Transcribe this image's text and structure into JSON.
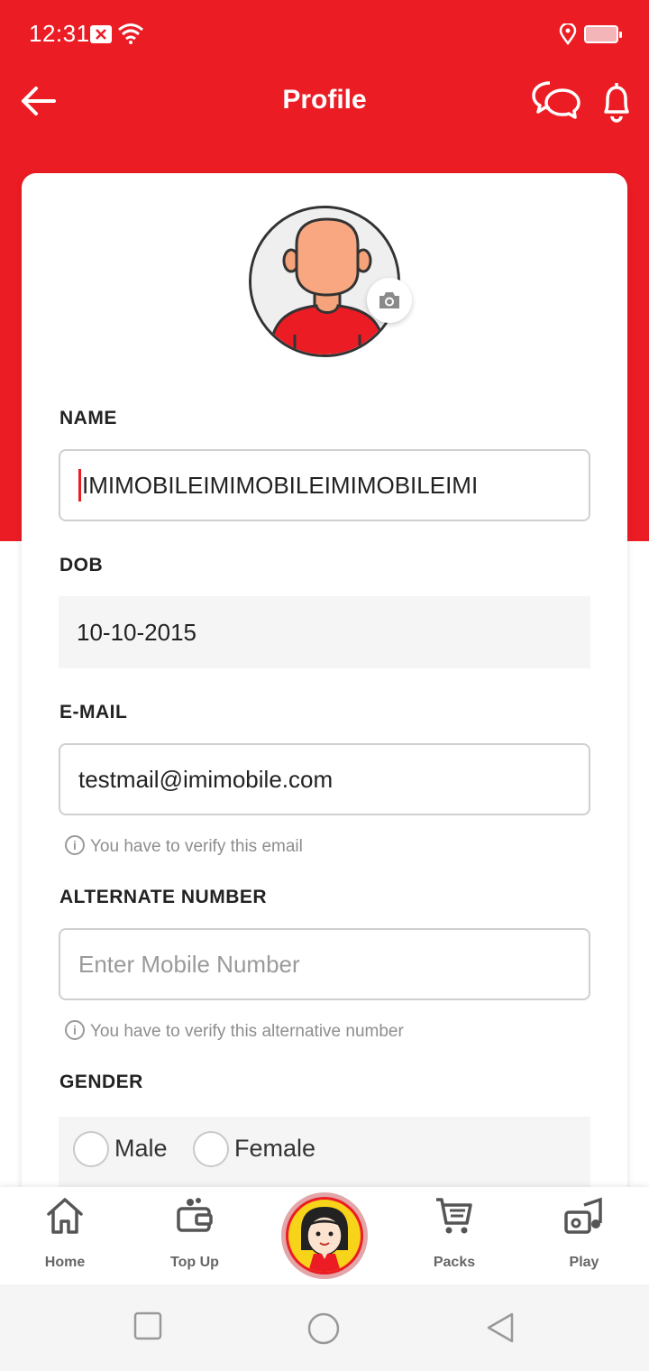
{
  "status_bar": {
    "time": "12:31"
  },
  "header": {
    "title": "Profile"
  },
  "form": {
    "name_label": "NAME",
    "name_value": "IMIMOBILEIMIMOBILEIMIMOBILEIMI",
    "dob_label": "DOB",
    "dob_value": "10-10-2015",
    "email_label": "E-MAIL",
    "email_value": "testmail@imimobile.com",
    "email_hint": "You have to verify this email",
    "alt_label": "ALTERNATE NUMBER",
    "alt_placeholder": "Enter Mobile Number",
    "alt_hint": "You have to verify this alternative number",
    "gender_label": "GENDER",
    "gender_options": [
      "Male",
      "Female"
    ]
  },
  "bottom_nav": {
    "items": [
      {
        "label": "Home",
        "icon": "home-icon"
      },
      {
        "label": "Top Up",
        "icon": "wallet-icon"
      },
      {
        "label": "Packs",
        "icon": "cart-icon"
      },
      {
        "label": "Play",
        "icon": "music-icon"
      }
    ]
  },
  "colors": {
    "brand": "#ec1c24",
    "field_border": "#cfcfcf",
    "hint": "#8e8e8e"
  }
}
